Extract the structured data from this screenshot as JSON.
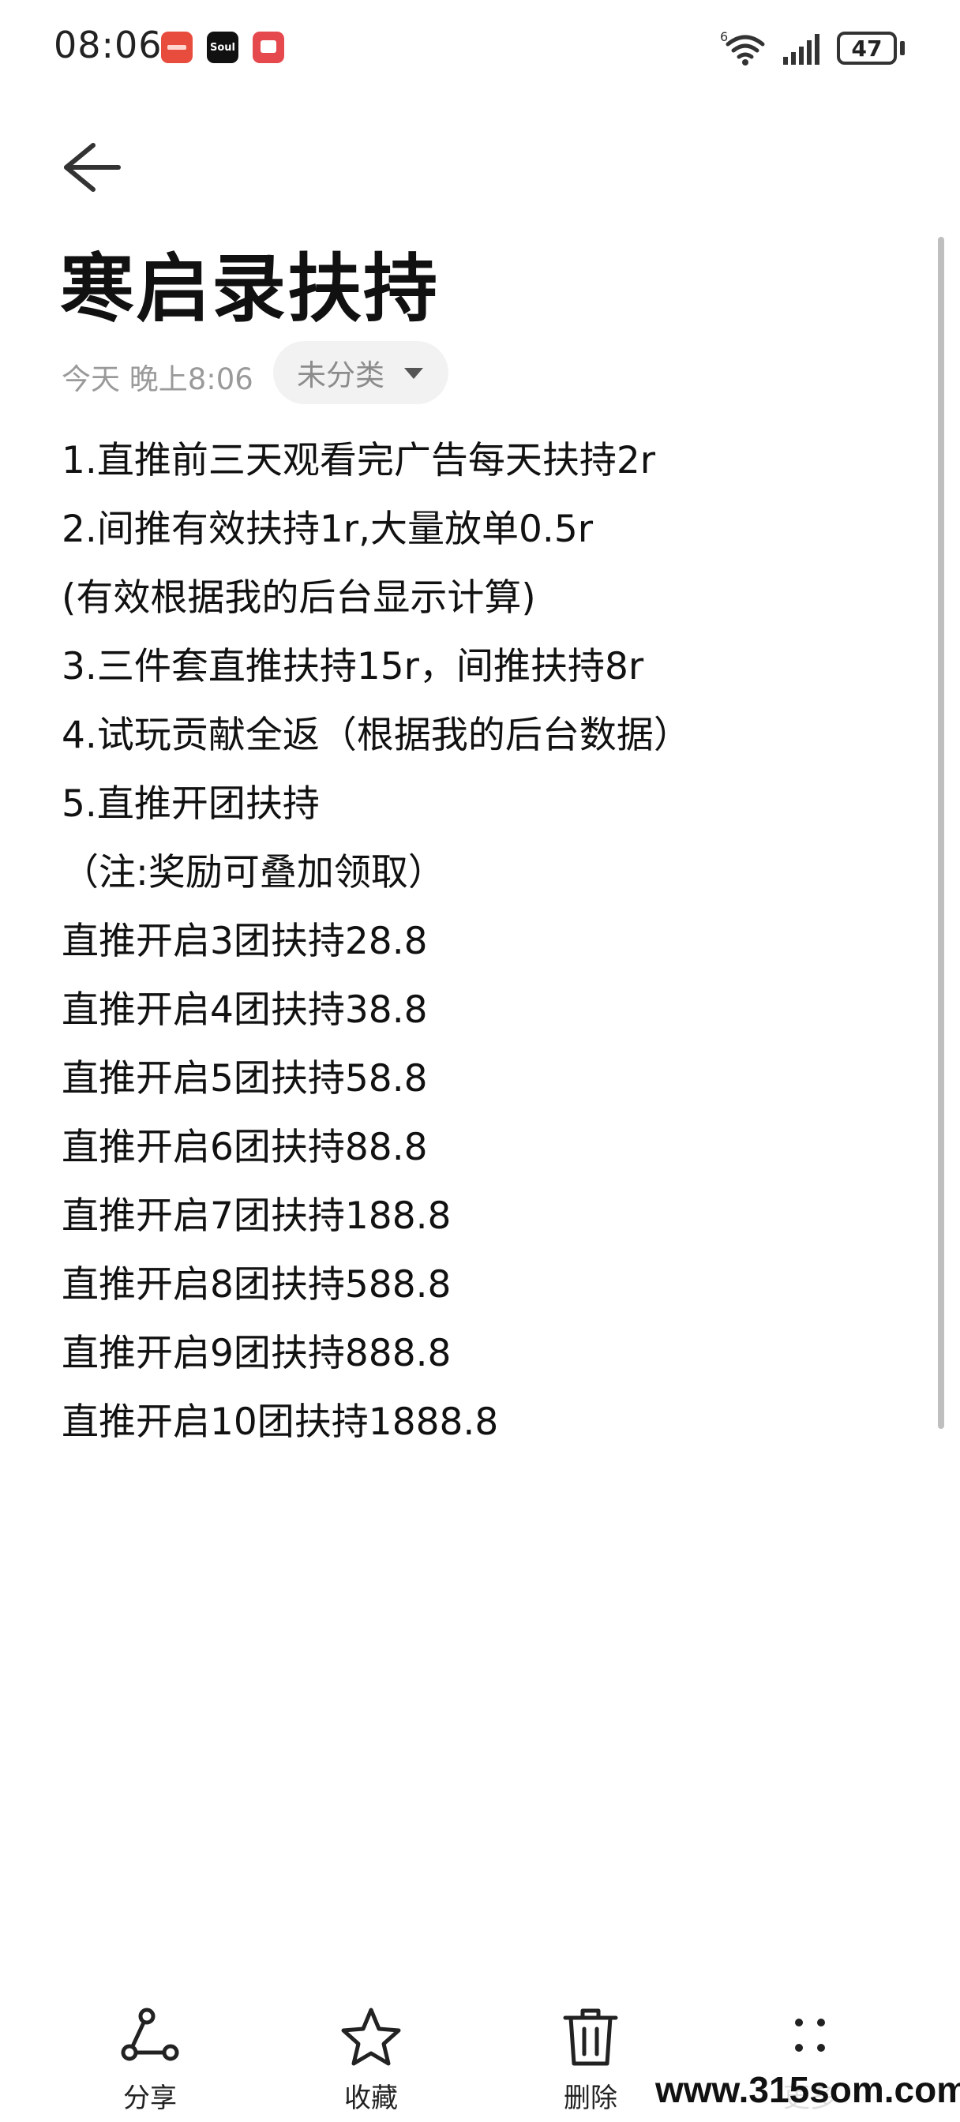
{
  "status_bar": {
    "time": "08:06",
    "soul_label": "Soul",
    "battery": "47",
    "network_label": "6"
  },
  "header": {
    "back_icon": "arrow-left-icon"
  },
  "note": {
    "title": "寒启录扶持",
    "date": "今天 晚上8:06",
    "category": "未分类",
    "lines": [
      "1.直推前三天观看完广告每天扶持2r",
      "2.间推有效扶持1r,大量放单0.5r",
      "(有效根据我的后台显示计算)",
      "3.三件套直推扶持15r，间推扶持8r",
      "4.试玩贡献全返（根据我的后台数据）",
      "5.直推开团扶持",
      "（注:奖励可叠加领取）",
      "直推开启3团扶持28.8",
      "直推开启4团扶持38.8",
      "直推开启5团扶持58.8",
      "直推开启6团扶持88.8",
      "直推开启7团扶持188.8",
      "直推开启8团扶持588.8",
      "直推开启9团扶持888.8",
      "直推开启10团扶持1888.8"
    ]
  },
  "toolbar": {
    "share_label": "分享",
    "favorite_label": "收藏",
    "delete_label": "删除",
    "more_label": "更多"
  },
  "watermark": "www.315som.com"
}
